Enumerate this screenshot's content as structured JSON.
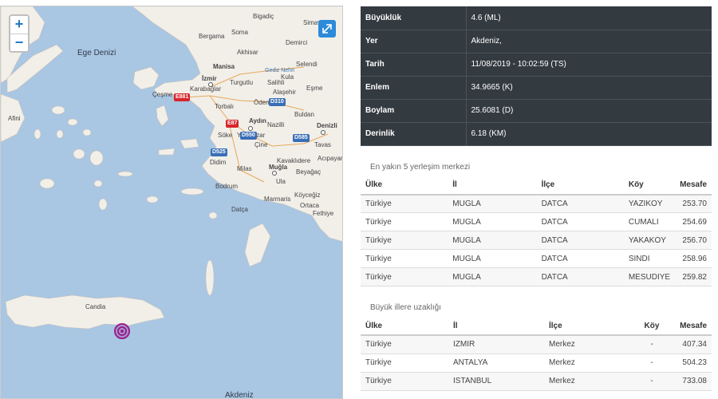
{
  "map": {
    "zoom_in": "+",
    "zoom_out": "−",
    "labels": {
      "ege_denizi": "Ege Denizi",
      "bigadic": "Bigadiç",
      "bergama": "Bergama",
      "soma": "Soma",
      "akhisar": "Akhisar",
      "demirci": "Demirci",
      "simav": "Simav",
      "kula": "Kula",
      "selendi": "Selendi",
      "manisa": "Manisa",
      "gediz": "Gediz Nehri",
      "izmir": "İzmir",
      "karabaglar": "Karabağlar",
      "cesme": "Çeşme",
      "turgutlu": "Turgutlu",
      "salihli": "Salihli",
      "alasehir": "Alaşehir",
      "esme": "Eşme",
      "torbali": "Torbalı",
      "odemis": "Ödemiş",
      "buldan": "Buldan",
      "aydin": "Aydın",
      "denizli": "Denizli",
      "nazilli": "Nazilli",
      "soke": "Söke",
      "yenipazar": "Yenipazar",
      "tavas": "Tavas",
      "cine": "Çine",
      "acipayam": "Acıpayam",
      "didim": "Didim",
      "kavaklidere": "Kavaklıdere",
      "milas": "Milas",
      "mugla": "Muğla",
      "beyagac": "Beyağaç",
      "bodrum": "Bodrum",
      "ula": "Ula",
      "koycegiz": "Köyceğiz",
      "marmaris": "Marmaris",
      "ortaca": "Ortaca",
      "datca": "Datça",
      "fethiye": "Fethiye",
      "afini": "Afini",
      "candia": "Candia",
      "akdeniz": "Akdeniz"
    },
    "roads": {
      "e881": "E881",
      "e87": "E87",
      "d310": "D310",
      "d550": "D550",
      "d525": "D525",
      "d585": "D585"
    }
  },
  "info": {
    "rows": [
      {
        "key": "Büyüklük",
        "value": "4.6 (ML)"
      },
      {
        "key": "Yer",
        "value": "Akdeniz,"
      },
      {
        "key": "Tarih",
        "value": "11/08/2019 - 10:02:59 (TS)"
      },
      {
        "key": "Enlem",
        "value": "34.9665 (K)"
      },
      {
        "key": "Boylam",
        "value": "25.6081 (D)"
      },
      {
        "key": "Derinlik",
        "value": "6.18 (KM)"
      }
    ]
  },
  "nearest": {
    "title": "En yakın 5 yerleşim merkezi",
    "headers": [
      "Ülke",
      "İl",
      "İlçe",
      "Köy",
      "Mesafe"
    ],
    "rows": [
      [
        "Türkiye",
        "MUGLA",
        "DATCA",
        "YAZIKOY",
        "253.70"
      ],
      [
        "Türkiye",
        "MUGLA",
        "DATCA",
        "CUMALI",
        "254.69"
      ],
      [
        "Türkiye",
        "MUGLA",
        "DATCA",
        "YAKAKOY",
        "256.70"
      ],
      [
        "Türkiye",
        "MUGLA",
        "DATCA",
        "SINDI",
        "258.96"
      ],
      [
        "Türkiye",
        "MUGLA",
        "DATCA",
        "MESUDIYE",
        "259.82"
      ]
    ]
  },
  "cities": {
    "title": "Büyük illere uzaklığı",
    "headers": [
      "Ülke",
      "İl",
      "İlçe",
      "Köy",
      "Mesafe"
    ],
    "rows": [
      [
        "Türkiye",
        "IZMIR",
        "Merkez",
        "-",
        "407.34"
      ],
      [
        "Türkiye",
        "ANTALYA",
        "Merkez",
        "-",
        "504.23"
      ],
      [
        "Türkiye",
        "ISTANBUL",
        "Merkez",
        "-",
        "733.08"
      ]
    ]
  },
  "colors": {
    "sea": "#a9c6e3",
    "land": "#f2efe9",
    "info_bg": "#333a40",
    "quake_marker": "#9b1c8c",
    "zoom_accent": "#1f79c6"
  }
}
